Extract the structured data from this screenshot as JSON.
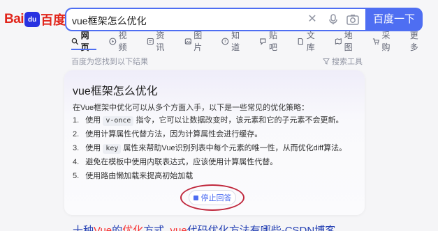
{
  "logo": {
    "bai": "Bai",
    "paw": "du",
    "du": "百度"
  },
  "search": {
    "value": "vue框架怎么优化",
    "button_label": "百度一下"
  },
  "tabs": [
    {
      "label": "网页",
      "icon": "search-icon"
    },
    {
      "label": "视频",
      "icon": "video-icon"
    },
    {
      "label": "资讯",
      "icon": "news-icon"
    },
    {
      "label": "图片",
      "icon": "image-icon"
    },
    {
      "label": "知道",
      "icon": "question-icon"
    },
    {
      "label": "贴吧",
      "icon": "tieba-icon"
    },
    {
      "label": "文库",
      "icon": "doc-icon"
    },
    {
      "label": "地图",
      "icon": "map-icon"
    },
    {
      "label": "采购",
      "icon": "cart-icon"
    },
    {
      "label": "更多",
      "icon": ""
    }
  ],
  "result_tip": "百度为您找到以下结果",
  "tools_label": "搜索工具",
  "ai_card": {
    "title": "vue框架怎么优化",
    "intro": "在Vue框架中优化可以从多个方面入手，以下是一些常见的优化策略：",
    "items": [
      {
        "num": "1.",
        "pre": "使用",
        "code": "v-once",
        "post": "指令，它可以让数据改变时，该元素和它的子元素不会更新。"
      },
      {
        "num": "2.",
        "pre": "使用计算属性代替方法，因为计算属性会进行缓存。",
        "code": "",
        "post": ""
      },
      {
        "num": "3.",
        "pre": "使用",
        "code": "key",
        "post": "属性来帮助Vue识别列表中每个元素的唯一性，从而优化diff算法。"
      },
      {
        "num": "4.",
        "pre": "避免在模板中使用内联表达式，应该使用计算属性代替。",
        "code": "",
        "post": ""
      },
      {
        "num": "5.",
        "pre": "使用路由懒加载来提高初始加载",
        "code": "",
        "post": ""
      }
    ],
    "stop_label": "停止回答"
  },
  "next_result": {
    "part1": "十种",
    "em1": "Vue",
    "part2": "的",
    "em2": "优化",
    "part3": "方式_",
    "em3": "vue",
    "part4": "代码优化方法有哪些-CSDN博客"
  },
  "colors": {
    "accent": "#4e6ef2",
    "brand_red": "#e1251b",
    "annotation_ring": "#c0283d"
  }
}
